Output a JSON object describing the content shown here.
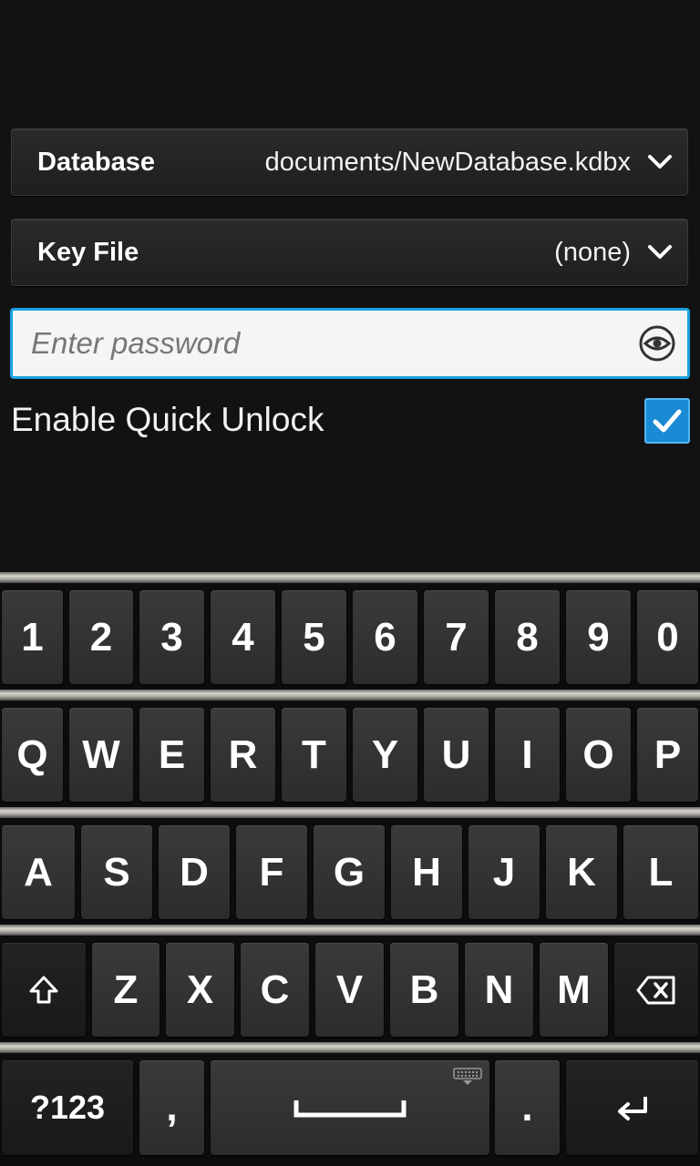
{
  "database": {
    "label": "Database",
    "value": "documents/NewDatabase.kdbx",
    "icon": "chevron-down-icon"
  },
  "keyfile": {
    "label": "Key File",
    "value": "(none)",
    "icon": "chevron-down-icon"
  },
  "password": {
    "placeholder": "Enter password",
    "value": "",
    "toggle_icon": "eye-icon"
  },
  "quick_unlock": {
    "label": "Enable Quick Unlock",
    "checked": true
  },
  "colors": {
    "accent": "#1ba1e2",
    "checkbox": "#1a8ad4",
    "background": "#121212"
  },
  "keyboard": {
    "row1": [
      "1",
      "2",
      "3",
      "4",
      "5",
      "6",
      "7",
      "8",
      "9",
      "0"
    ],
    "row2": [
      "Q",
      "W",
      "E",
      "R",
      "T",
      "Y",
      "U",
      "I",
      "O",
      "P"
    ],
    "row3": [
      "A",
      "S",
      "D",
      "F",
      "G",
      "H",
      "J",
      "K",
      "L"
    ],
    "row4": [
      "Z",
      "X",
      "C",
      "V",
      "B",
      "N",
      "M"
    ],
    "symbols_label": "?123",
    "comma": ",",
    "period": ".",
    "icons": {
      "shift": "shift-icon",
      "backspace": "backspace-icon",
      "space": "space-icon",
      "keyboard": "keyboard-icon",
      "enter": "enter-icon"
    }
  }
}
